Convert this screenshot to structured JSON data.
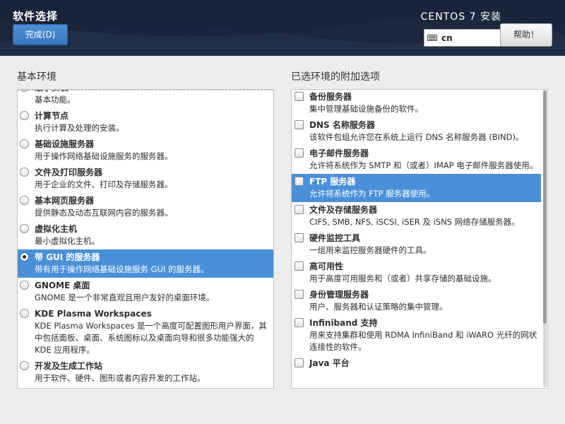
{
  "header": {
    "title": "软件选择",
    "done_label": "完成(D)",
    "install_title": "CENTOS 7 安装",
    "keyboard_layout": "cn",
    "help_label": "帮助！"
  },
  "base_environment": {
    "heading": "基本环境",
    "items": [
      {
        "title": "最小安装",
        "desc": "基本功能。",
        "selected": false
      },
      {
        "title": "计算节点",
        "desc": "执行计算及处理的安装。",
        "selected": false
      },
      {
        "title": "基础设施服务器",
        "desc": "用于操作网络基础设施服务的服务器。",
        "selected": false
      },
      {
        "title": "文件及打印服务器",
        "desc": "用于企业的文件、打印及存储服务器。",
        "selected": false
      },
      {
        "title": "基本网页服务器",
        "desc": "提供静态及动态互联网内容的服务器。",
        "selected": false
      },
      {
        "title": "虚拟化主机",
        "desc": "最小虚拟化主机。",
        "selected": false
      },
      {
        "title": "带 GUI 的服务器",
        "desc": "带有用于操作网络基础设施服务 GUI 的服务器。",
        "selected": true
      },
      {
        "title": "GNOME 桌面",
        "desc": "GNOME 是一个非常直观且用户友好的桌面环境。",
        "selected": false
      },
      {
        "title": "KDE Plasma Workspaces",
        "desc": "KDE Plasma Workspaces 是一个高度可配置图形用户界面，其中包括面板、桌面、系统图标以及桌面向导和很多功能强大的 KDE 应用程序。",
        "selected": false
      },
      {
        "title": "开发及生成工作站",
        "desc": "用于软件、硬件、图形或者内容开发的工作站。",
        "selected": false
      }
    ]
  },
  "addons": {
    "heading": "已选环境的附加选项",
    "items": [
      {
        "title": "备份服务器",
        "desc": "集中管理基础设施备份的软件。",
        "selected": false
      },
      {
        "title": "DNS 名称服务器",
        "desc": "该软件包组允许您在系统上运行 DNS 名称服务器 (BIND)。",
        "selected": false
      },
      {
        "title": "电子邮件服务器",
        "desc": "允许将系统作为 SMTP 和（或者）IMAP 电子邮件服务器使用。",
        "selected": false
      },
      {
        "title": "FTP 服务器",
        "desc": "允许将系统作为 FTP 服务器使用。",
        "selected": true
      },
      {
        "title": "文件及存储服务器",
        "desc": "CIFS, SMB, NFS, iSCSI, iSER 及 iSNS 网络存储服务器。",
        "selected": false
      },
      {
        "title": "硬件监控工具",
        "desc": "一组用来监控服务器硬件的工具。",
        "selected": false
      },
      {
        "title": "高可用性",
        "desc": "用于高度可用服务和（或者）共享存储的基础设施。",
        "selected": false
      },
      {
        "title": "身份管理服务器",
        "desc": "用户、服务器和认证策略的集中管理。",
        "selected": false
      },
      {
        "title": "Infiniband 支持",
        "desc": "用来支持集群和使用 RDMA InfiniBand 和 iWARO 光纤的网状连接性的软件。",
        "selected": false
      },
      {
        "title": "Java 平台",
        "desc": "",
        "selected": false
      }
    ]
  }
}
